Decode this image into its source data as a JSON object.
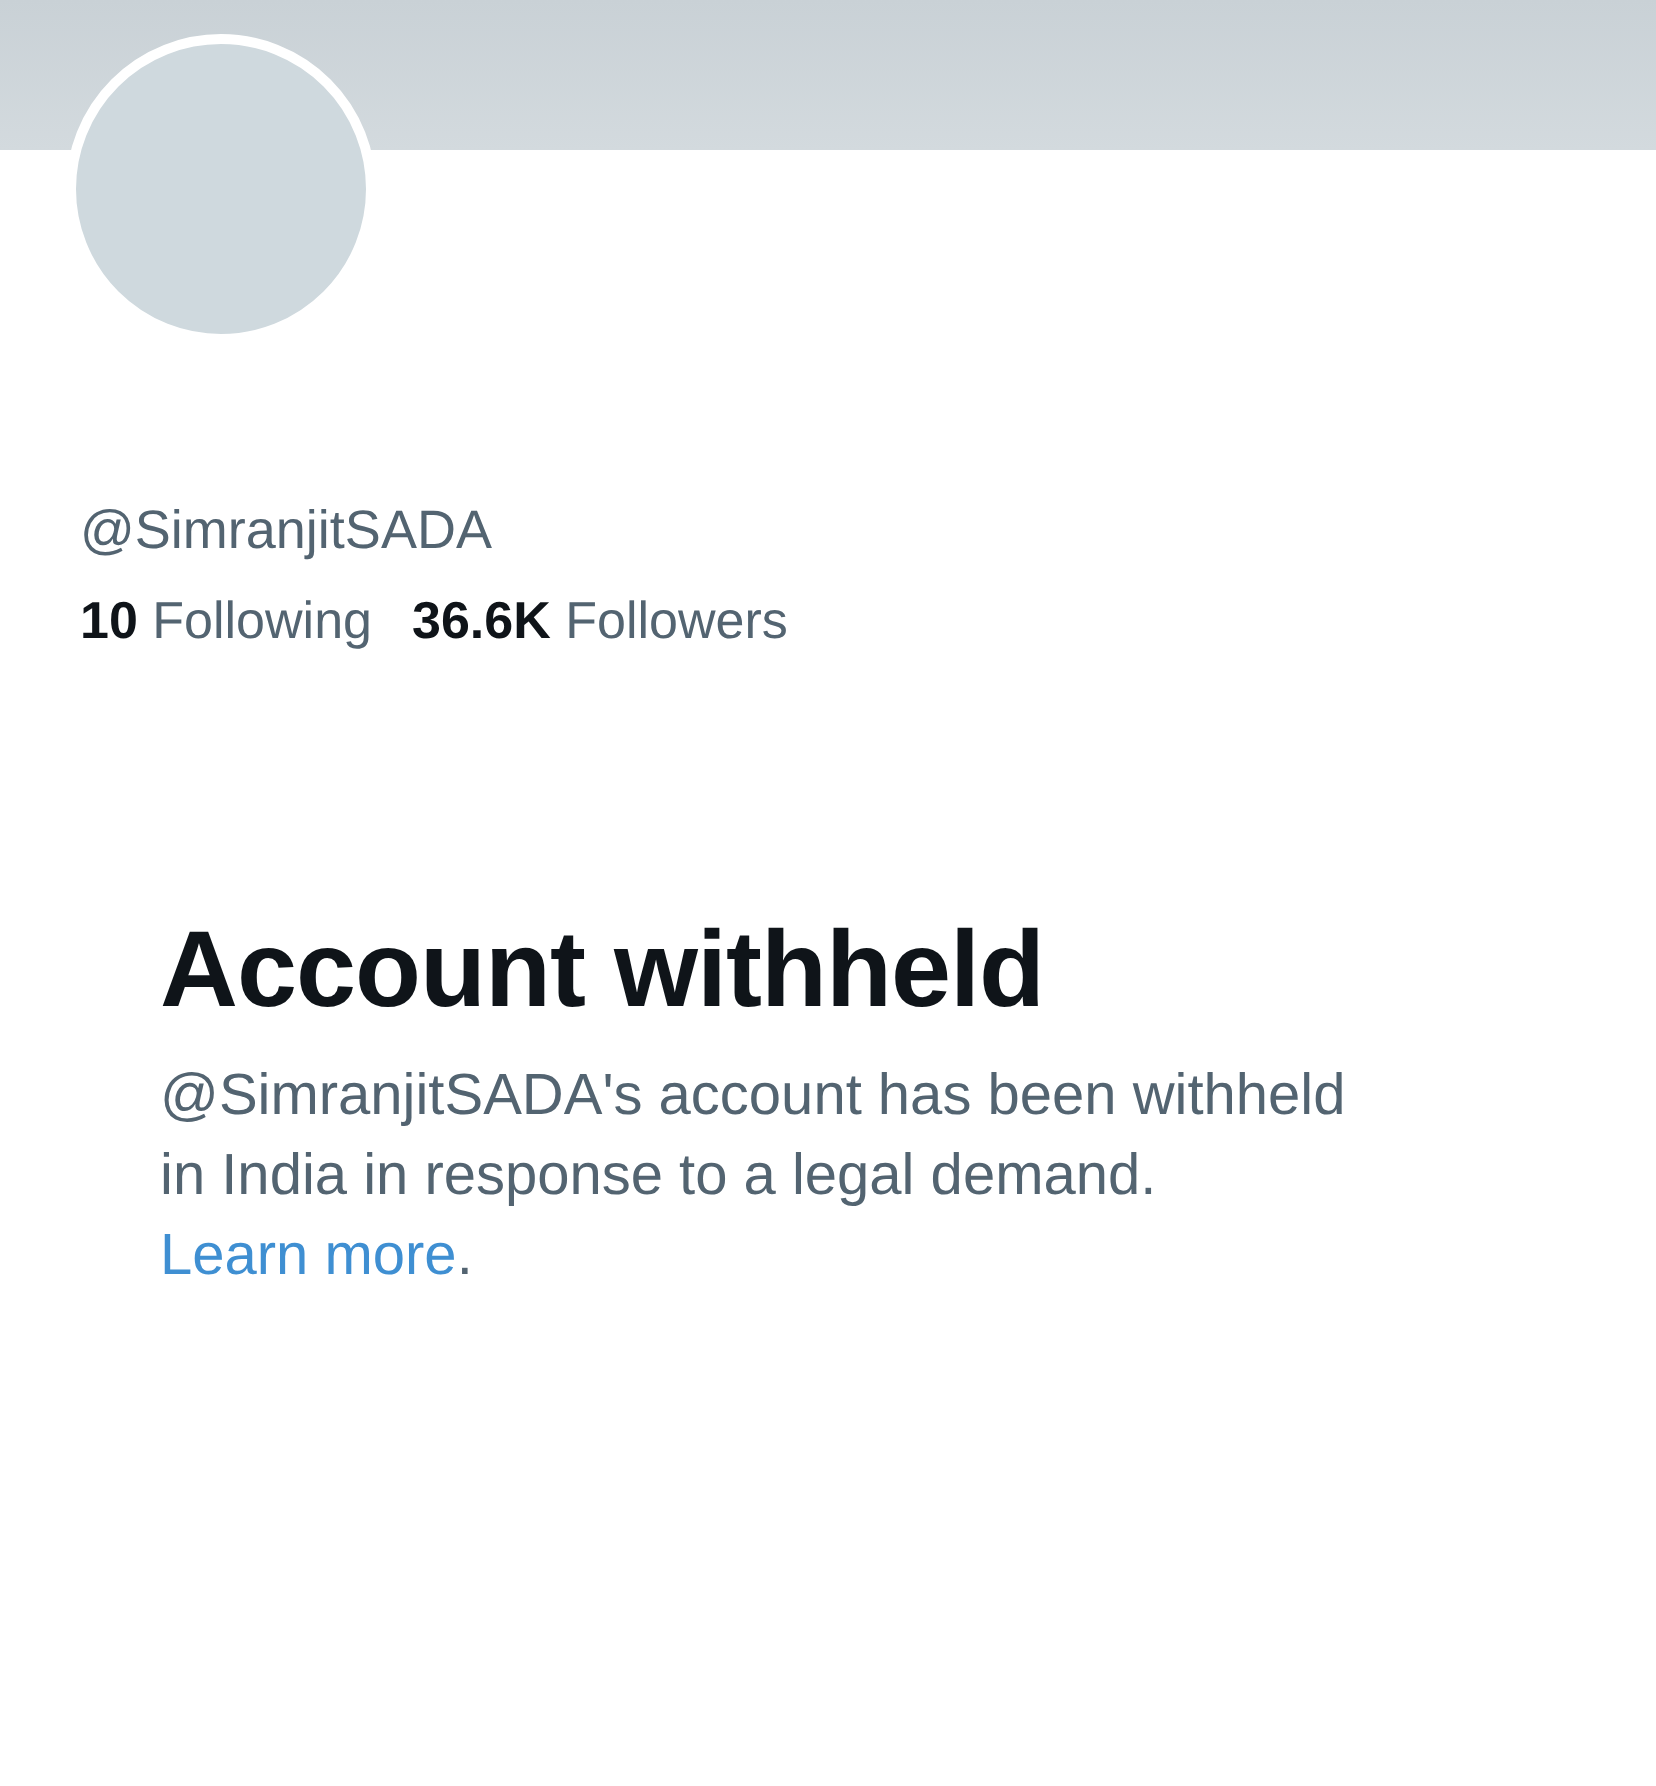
{
  "profile": {
    "handle": "@SimranjitSADA",
    "stats": [
      {
        "count": "10",
        "label": "Following"
      },
      {
        "count": "36.6K",
        "label": "Followers"
      }
    ]
  },
  "notice": {
    "title": "Account withheld",
    "body": "@SimranjitSADA's account has been withheld in India in response to a legal demand. ",
    "link": "Learn more",
    "after": "."
  }
}
